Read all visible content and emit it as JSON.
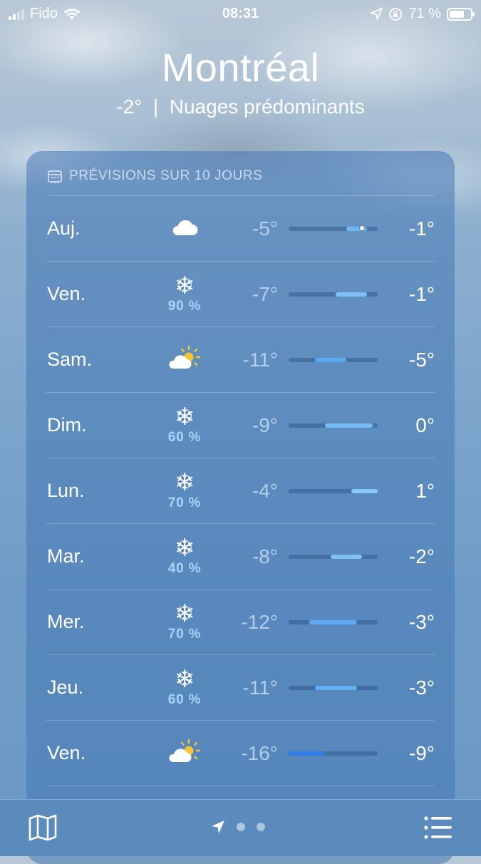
{
  "status_bar": {
    "carrier": "Fido",
    "time": "08:31",
    "battery_percent": "71 %",
    "battery_level": 0.71
  },
  "header": {
    "city": "Montréal",
    "temp": "-2°",
    "separator": "|",
    "condition": "Nuages prédominants"
  },
  "forecast": {
    "title": "PRÉVISIONS SUR 10 JOURS",
    "scale_min": -16,
    "scale_max": 1,
    "current_temp": -2,
    "days": [
      {
        "day": "Auj.",
        "icon": "cloud-icon",
        "precip": "",
        "low": "-5°",
        "high": "-1°",
        "low_value": -5,
        "high_value": -1,
        "color": "#6fb8f5"
      },
      {
        "day": "Ven.",
        "icon": "snowflake-icon",
        "precip": "90 %",
        "low": "-7°",
        "high": "-1°",
        "low_value": -7,
        "high_value": -1,
        "color": "#7ec0f5"
      },
      {
        "day": "Sam.",
        "icon": "partly-sunny-icon",
        "precip": "",
        "low": "-11°",
        "high": "-5°",
        "low_value": -11,
        "high_value": -5,
        "color": "#5aaaf0"
      },
      {
        "day": "Dim.",
        "icon": "snowflake-icon",
        "precip": "60 %",
        "low": "-9°",
        "high": "0°",
        "low_value": -9,
        "high_value": 0,
        "color": "#74bbf4"
      },
      {
        "day": "Lun.",
        "icon": "snowflake-icon",
        "precip": "70 %",
        "low": "-4°",
        "high": "1°",
        "low_value": -4,
        "high_value": 1,
        "color": "#88c8f5"
      },
      {
        "day": "Mar.",
        "icon": "snowflake-icon",
        "precip": "40 %",
        "low": "-8°",
        "high": "-2°",
        "low_value": -8,
        "high_value": -2,
        "color": "#7cc0f5"
      },
      {
        "day": "Mer.",
        "icon": "snowflake-icon",
        "precip": "70 %",
        "low": "-12°",
        "high": "-3°",
        "low_value": -12,
        "high_value": -3,
        "color": "#5eaaf2"
      },
      {
        "day": "Jeu.",
        "icon": "snowflake-icon",
        "precip": "60 %",
        "low": "-11°",
        "high": "-3°",
        "low_value": -11,
        "high_value": -3,
        "color": "#62aef2"
      },
      {
        "day": "Ven.",
        "icon": "partly-sunny-icon",
        "precip": "",
        "low": "-16°",
        "high": "-9°",
        "low_value": -16,
        "high_value": -9,
        "color": "#2f7fe6"
      },
      {
        "day": "",
        "icon": "snowflake-icon",
        "precip": "",
        "low": "",
        "high": "",
        "low_value": null,
        "high_value": null,
        "color": ""
      }
    ]
  },
  "tab_bar": {
    "page_count": 3,
    "active_page": 0
  }
}
